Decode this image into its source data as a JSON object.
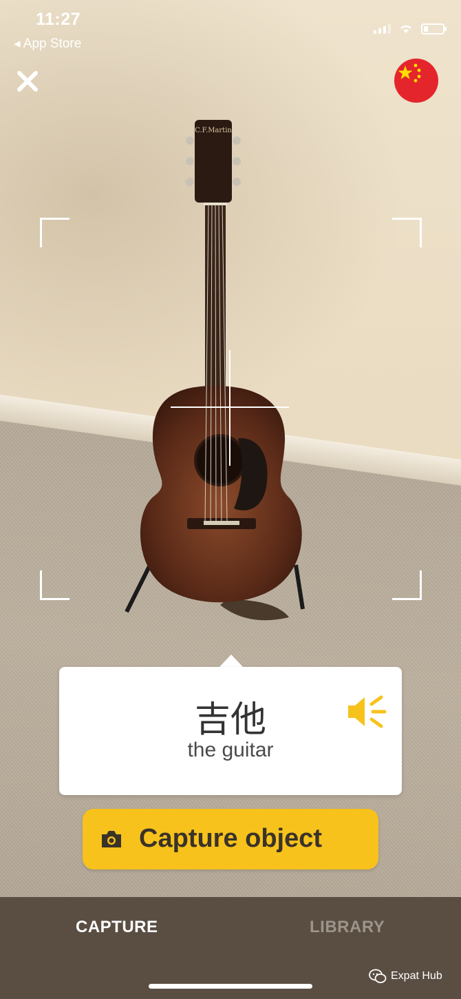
{
  "status_bar": {
    "time": "11:27",
    "back_label": "◂ App Store"
  },
  "header": {
    "close_icon": "close-icon",
    "language_flag": "china-flag-icon"
  },
  "translation": {
    "word": "吉他",
    "meaning": "the guitar",
    "audio_icon": "speaker-icon"
  },
  "capture_button": {
    "label": "Capture object",
    "icon": "camera-icon"
  },
  "tabs": [
    {
      "label": "CAPTURE",
      "active": true
    },
    {
      "label": "LIBRARY",
      "active": false
    }
  ],
  "watermark": {
    "label": "Expat Hub"
  },
  "colors": {
    "accent": "#f7c21c",
    "tabbar": "#5a4e43",
    "flag_red": "#e4262c",
    "flag_star": "#ffde00"
  }
}
